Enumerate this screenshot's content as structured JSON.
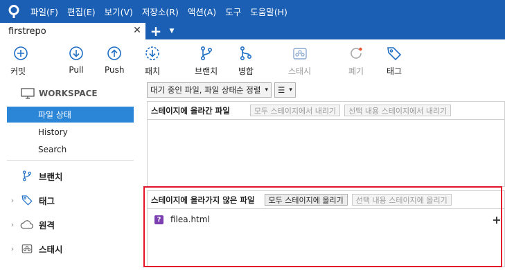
{
  "menubar": {
    "items": [
      "파일(F)",
      "편집(E)",
      "보기(V)",
      "저장소(R)",
      "액션(A)",
      "도구",
      "도움말(H)"
    ]
  },
  "tabs": {
    "active_label": "firstrepo",
    "close_glyph": "✕",
    "add_glyph": "+",
    "dropdown_glyph": "▼"
  },
  "toolbar": {
    "commit": "커밋",
    "pull": "Pull",
    "push": "Push",
    "fetch": "패치",
    "branch": "브랜치",
    "merge": "병합",
    "stash": "스태시",
    "discard": "폐기",
    "tag": "태그"
  },
  "sidebar": {
    "workspace": "WORKSPACE",
    "items": [
      "파일 상태",
      "History",
      "Search"
    ],
    "selected_index": 0,
    "groups": {
      "branch": "브랜치",
      "tag": "태그",
      "remote": "원격",
      "stash": "스태시"
    },
    "chevron": "›"
  },
  "main": {
    "filter_label": "대기 중인 파일, 파일 상태순 정렬",
    "list_glyph": "☰",
    "caret": "▾",
    "staged": {
      "title": "스테이지에 올라간 파일",
      "unstage_all": "모두 스테이지에서 내리기",
      "unstage_selected": "선택 내용 스테이지에서 내리기"
    },
    "unstaged": {
      "title": "스테이지에 올라가지 않은 파일",
      "stage_all": "모두 스테이지에 올리기",
      "stage_selected": "선택 내용 스테이지에 올리기",
      "files": [
        {
          "status_glyph": "?",
          "name": "filea.html"
        }
      ],
      "plus_glyph": "+"
    }
  },
  "colors": {
    "menubar_bg": "#1a5fb4",
    "selection": "#2c86d8",
    "highlight_border": "#e3132a",
    "untracked_icon": "#7b3fb0",
    "toolbar_icon": "#1f6fc5"
  }
}
